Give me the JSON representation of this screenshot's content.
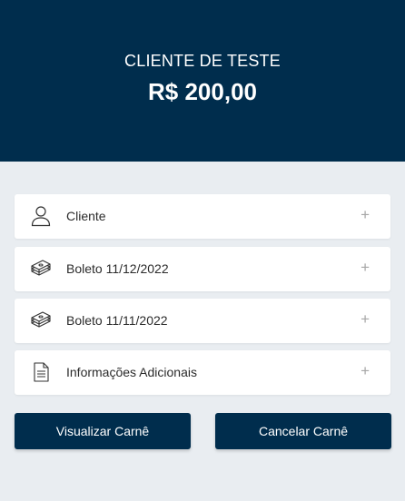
{
  "header": {
    "client_name": "CLIENTE DE TESTE",
    "amount": "R$ 200,00"
  },
  "sections": [
    {
      "icon": "user-icon",
      "label": "Cliente"
    },
    {
      "icon": "money-stack-icon",
      "label": "Boleto 11/12/2022"
    },
    {
      "icon": "money-stack-icon",
      "label": "Boleto 11/11/2022"
    },
    {
      "icon": "document-icon",
      "label": "Informações Adicionais"
    }
  ],
  "expand_symbol": "+",
  "actions": {
    "view_label": "Visualizar Carnê",
    "cancel_label": "Cancelar Carnê"
  },
  "colors": {
    "primary": "#002d4d",
    "background": "#e9edf1"
  }
}
